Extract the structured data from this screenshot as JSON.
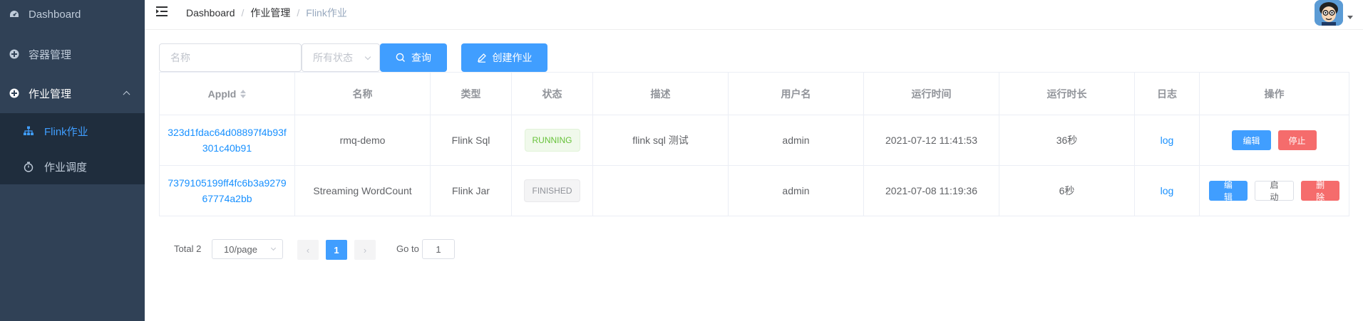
{
  "sidebar": {
    "items": [
      {
        "label": "Dashboard",
        "icon": "dashboard-icon"
      },
      {
        "label": "容器管理",
        "icon": "component-icon"
      },
      {
        "label": "作业管理",
        "icon": "component-icon"
      }
    ],
    "submenu": [
      {
        "label": "Flink作业",
        "icon": "tree-icon",
        "active": true
      },
      {
        "label": "作业调度",
        "icon": "timer-icon"
      }
    ],
    "background": "#304156",
    "submenu_background": "#1f2d3d",
    "active_color": "#409eff"
  },
  "navbar": {
    "breadcrumb": [
      "Dashboard",
      "作业管理",
      "Flink作业"
    ],
    "breadcrumb_separator": "/"
  },
  "filters": {
    "name_placeholder": "名称",
    "status_placeholder": "所有状态",
    "query_label": "查询",
    "create_label": "创建作业"
  },
  "table": {
    "columns": [
      "AppId",
      "名称",
      "类型",
      "状态",
      "描述",
      "用户名",
      "运行时间",
      "运行时长",
      "日志",
      "操作"
    ],
    "rows": [
      {
        "appid": "323d1fdac64d08897f4b93f301c40b91",
        "name": "rmq-demo",
        "type": "Flink Sql",
        "status": "RUNNING",
        "desc": "flink sql 测试",
        "user": "admin",
        "time": "2021-07-12 11:41:53",
        "duration": "36秒",
        "log": "log",
        "actions": [
          "编辑",
          "停止"
        ]
      },
      {
        "appid": "7379105199ff4fc6b3a927967774a2bb",
        "name": "Streaming WordCount",
        "type": "Flink Jar",
        "status": "FINISHED",
        "desc": "",
        "user": "admin",
        "time": "2021-07-08 11:19:36",
        "duration": "6秒",
        "log": "log",
        "actions": [
          "编辑",
          "启动",
          "删除"
        ]
      }
    ]
  },
  "pagination": {
    "total": "Total 2",
    "page_size": "10/page",
    "prev": "‹",
    "current": "1",
    "next": "›",
    "goto_label": "Go to",
    "goto_value": "1"
  },
  "colors": {
    "primary": "#409eff",
    "danger": "#f56c6c",
    "success": "#67c23a"
  }
}
